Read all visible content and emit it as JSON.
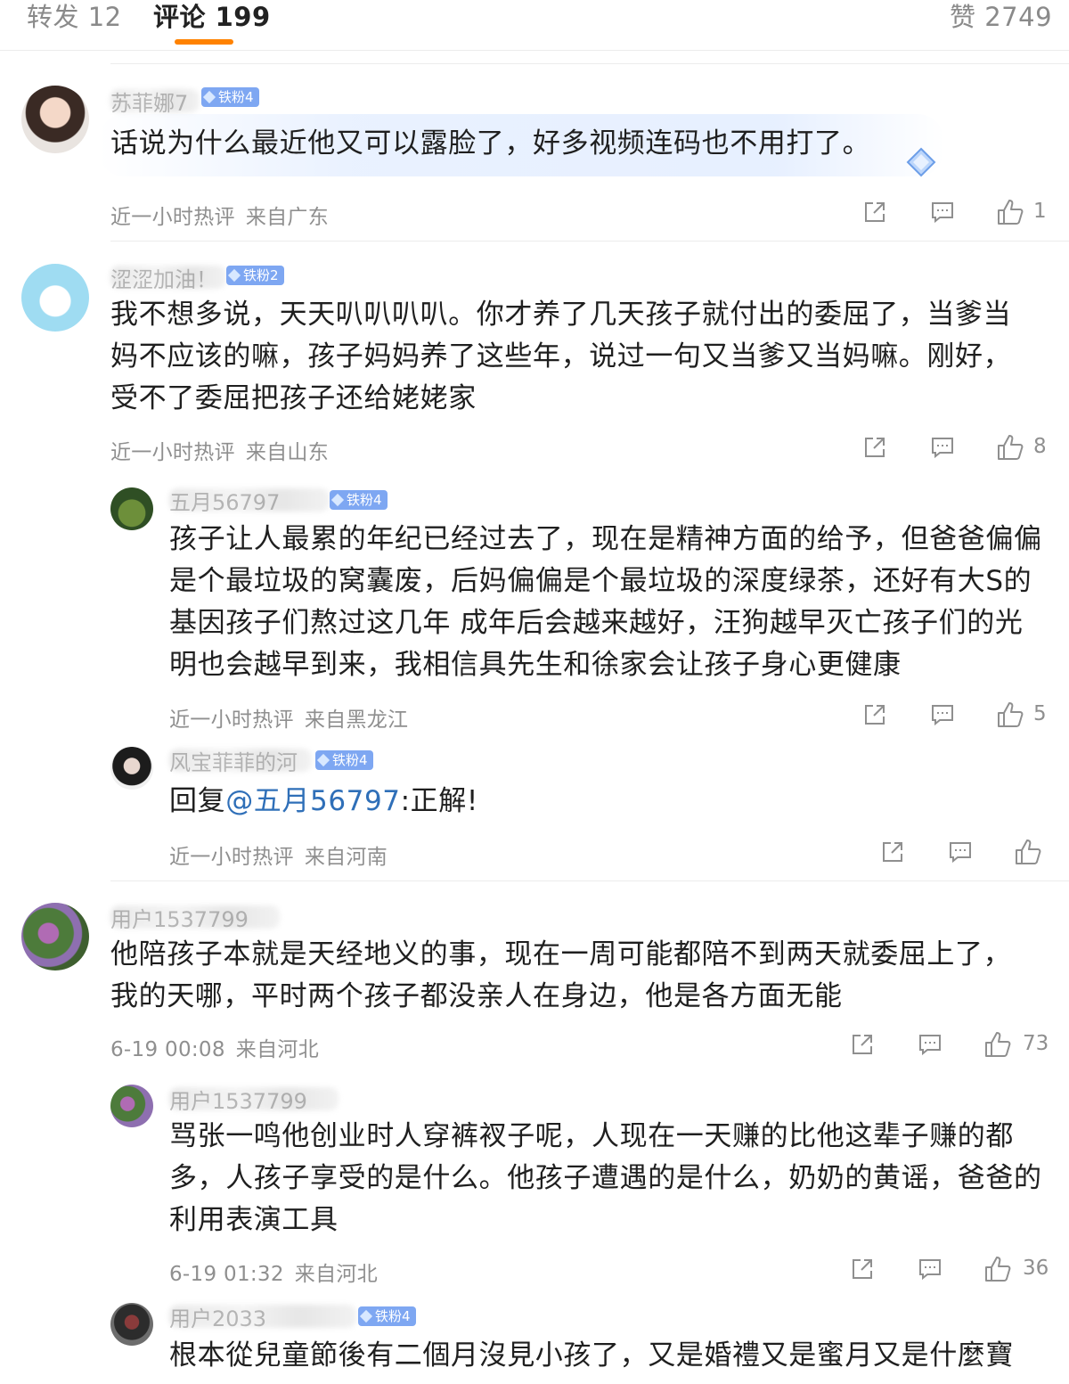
{
  "tabs": {
    "repost": "转发 12",
    "comments": "评论 199",
    "likes": "赞 2749"
  },
  "comments": [
    {
      "name": "苏菲娜7",
      "badge": "铁粉4",
      "text": "话说为什么最近他又可以露脸了，好多视频连码也不用打了。",
      "time": "近一小时热评",
      "location": "来自广东",
      "likes": "1"
    },
    {
      "name": "涩涩加油！",
      "badge": "铁粉2",
      "text": "我不想多说，天天叭叭叭叭。你才养了几天孩子就付出的委屈了，当爹当妈不应该的嘛，孩子妈妈养了这些年，说过一句又当爹又当妈嘛。刚好，受不了委屈把孩子还给姥姥家",
      "time": "近一小时热评",
      "location": "来自山东",
      "likes": "8"
    },
    {
      "name": "五月56797",
      "badge": "铁粉4",
      "text": "孩子让人最累的年纪已经过去了，现在是精神方面的给予，但爸爸偏偏是个最垃圾的窝囊废，后妈偏偏是个最垃圾的深度绿茶，还好有大S的基因孩子们熬过这几年 成年后会越来越好，汪狗越早灭亡孩子们的光明也会越早到来，我相信具先生和徐家会让孩子身心更健康",
      "time": "近一小时热评",
      "location": "来自黑龙江",
      "likes": "5"
    },
    {
      "name": "风宝菲菲的河",
      "badge": "铁粉4",
      "reply_prefix": "回复",
      "mention": "@五月56797",
      "text": ":正解!",
      "time": "近一小时热评",
      "location": "来自河南",
      "likes": ""
    },
    {
      "name": "用户1537799",
      "text": "他陪孩子本就是天经地义的事，现在一周可能都陪不到两天就委屈上了，我的天哪，平时两个孩子都没亲人在身边，他是各方面无能",
      "time": "6-19 00:08",
      "location": "来自河北",
      "likes": "73"
    },
    {
      "name": "用户1537799",
      "text": "骂张一鸣他创业时人穿裤衩子呢，人现在一天赚的比他这辈子赚的都多，人孩子享受的是什么。他孩子遭遇的是什么，奶奶的黄谣，爸爸的利用表演工具",
      "time": "6-19 01:32",
      "location": "来自河北",
      "likes": "36"
    },
    {
      "name": "用户2033",
      "badge": "铁粉4",
      "text": "根本從兒童節後有二個月沒見小孩了，又是婚禮又是蜜月又是什麼寶"
    }
  ],
  "icons": {
    "share": "share-icon",
    "comment": "comment-icon",
    "like": "thumbs-up-icon"
  },
  "colors": {
    "accent": "#ff8200",
    "mention": "#2f6fb8",
    "badge": "#7ea7f2"
  }
}
